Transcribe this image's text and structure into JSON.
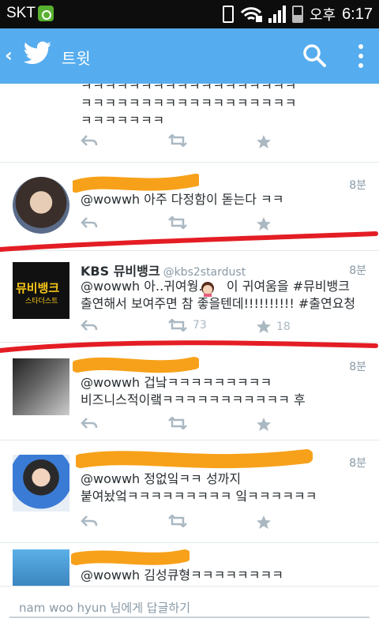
{
  "status_bar": {
    "carrier": "SKT",
    "ampm": "오후",
    "time": "6:17"
  },
  "action_bar": {
    "title": "트윗",
    "icons": [
      "back-icon",
      "twitter-bird-icon",
      "search-icon",
      "overflow-menu-icon"
    ]
  },
  "tweets": [
    {
      "text": "ㅋㅋㅋㅋㅋㅋㅋㅋㅋㅋㅋㅋㅋㅋㅋㅋㅋㅋ\nㅋㅋㅋㅋㅋㅋㅋㅋㅋㅋㅋㅋㅋㅋㅋㅋㅋㅋ\nㅋㅋㅋㅋㅋㅋㅋ"
    },
    {
      "time": "8분",
      "text": "@wowwh 아주 다정함이 돋는다 ㅋㅋ"
    },
    {
      "name": "KBS 뮤비뱅크",
      "handle": "@kbs2stardust",
      "time": "8분",
      "avatar_text": "뮤비뱅크",
      "avatar_sub": "스타더스트",
      "text": "@wowwh 아..귀여웡...    이 귀여움을 #뮤비뱅크\n출연해서 보여주면 참 좋을텐데!!!!!!!!!! #출연요청",
      "retweets": "73",
      "favorites": "18"
    },
    {
      "time": "8분",
      "text": "@wowwh 겁낰ㅋㅋㅋㅋㅋㅋㅋㅋㅋ\n비즈니스적이랰ㅋㅋㅋㅋㅋㅋㅋㅋㅋㅋㅋ 후"
    },
    {
      "time": "8분",
      "text": "@wowwh 정없잌ㅋㅋ 성까지\n붙여놨엌ㅋㅋㅋㅋㅋㅋㅋㅋㅋ 잌ㅋㅋㅋㅋㅋㅋ"
    },
    {
      "text": "@wowwh 김성큐형ㅋㅋㅋㅋㅋㅋㅋㅋ"
    }
  ],
  "reply_bar": {
    "placeholder": "nam woo hyun 님에게 답글하기"
  },
  "colors": {
    "status_bar": "#0d0d0d",
    "action_bar": "#55acee",
    "text": "#292f33",
    "muted": "#8899a6",
    "icon": "#aab8c2",
    "scribble_orange": "#f7a11a",
    "scribble_red": "#e41d24"
  }
}
